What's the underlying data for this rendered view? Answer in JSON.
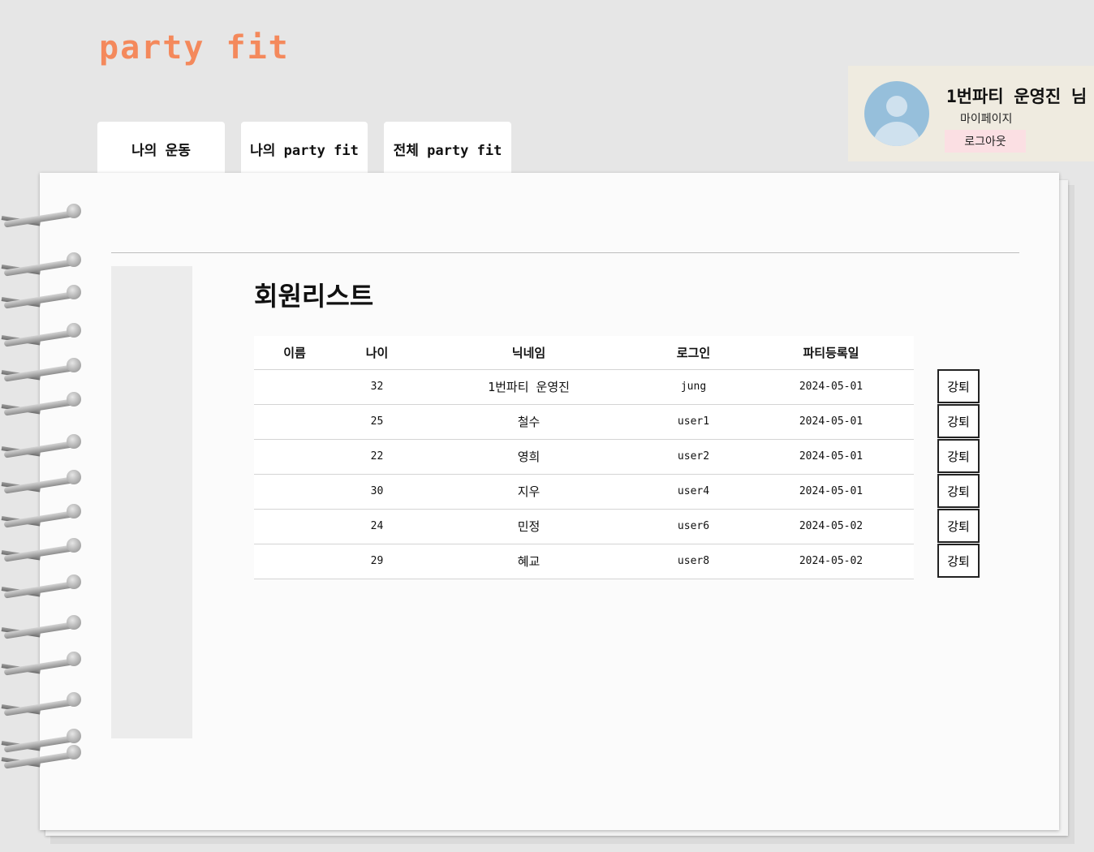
{
  "app": {
    "logo": "party fit"
  },
  "profile": {
    "name": "1번파티 운영진 님",
    "mypage_label": "마이페이지",
    "logout_label": "로그아웃",
    "avatar_icon": "user-avatar-icon"
  },
  "tabs": [
    {
      "label": "나의 운동"
    },
    {
      "label": "나의 party fit"
    },
    {
      "label": "전체 party fit"
    }
  ],
  "main": {
    "title": "회원리스트",
    "columns": [
      "이름",
      "나이",
      "닉네임",
      "로그인",
      "파티등록일"
    ],
    "rows": [
      {
        "name": "",
        "age": "32",
        "nickname": "1번파티 운영진",
        "login": "jung",
        "date": "2024-05-01",
        "action": "강퇴"
      },
      {
        "name": "",
        "age": "25",
        "nickname": "철수",
        "login": "user1",
        "date": "2024-05-01",
        "action": "강퇴"
      },
      {
        "name": "",
        "age": "22",
        "nickname": "영희",
        "login": "user2",
        "date": "2024-05-01",
        "action": "강퇴"
      },
      {
        "name": "",
        "age": "30",
        "nickname": "지우",
        "login": "user4",
        "date": "2024-05-01",
        "action": "강퇴"
      },
      {
        "name": "",
        "age": "24",
        "nickname": "민정",
        "login": "user6",
        "date": "2024-05-02",
        "action": "강퇴"
      },
      {
        "name": "",
        "age": "29",
        "nickname": "혜교",
        "login": "user8",
        "date": "2024-05-02",
        "action": "강퇴"
      }
    ]
  },
  "colors": {
    "logo": "#f4895c",
    "profile_bg": "#efebe0",
    "logout_bg": "#fbdfe3",
    "avatar": "#96bfdb",
    "page_bg": "#e6e6e6"
  }
}
